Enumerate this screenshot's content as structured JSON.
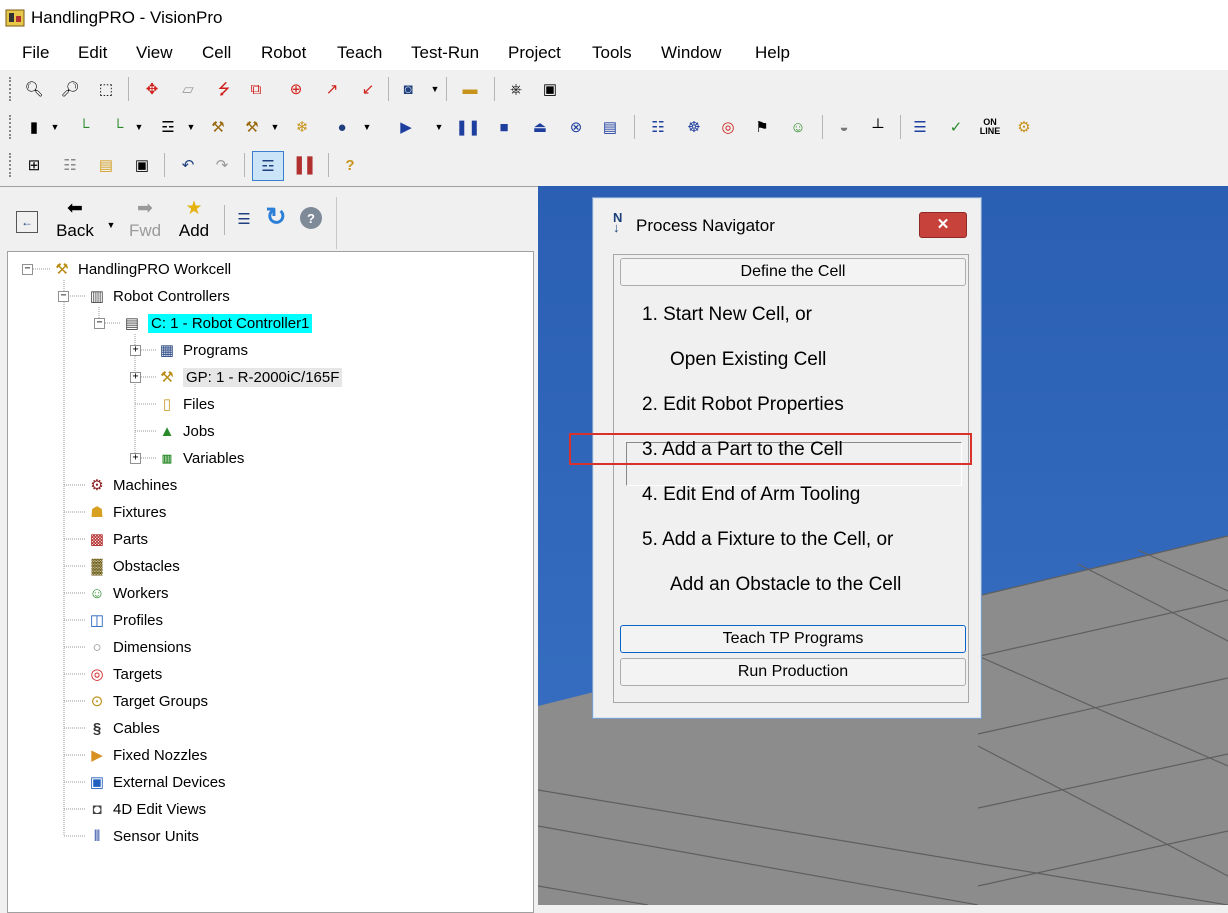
{
  "window": {
    "title": "HandlingPRO - VisionPro"
  },
  "menu": [
    "File",
    "Edit",
    "View",
    "Cell",
    "Robot",
    "Teach",
    "Test-Run",
    "Project",
    "Tools",
    "Window",
    "Help"
  ],
  "toolbar3": {
    "online_top": "ON",
    "online_bottom": "LINE"
  },
  "nav": {
    "back": "Back",
    "fwd": "Fwd",
    "add": "Add"
  },
  "tree": {
    "root": "HandlingPRO Workcell",
    "controllers": "Robot Controllers",
    "controller1": "C: 1 - Robot Controller1",
    "programs": "Programs",
    "robot": "GP: 1 - R-2000iC/165F",
    "files": "Files",
    "jobs": "Jobs",
    "variables": "Variables",
    "machines": "Machines",
    "fixtures": "Fixtures",
    "parts": "Parts",
    "obstacles": "Obstacles",
    "workers": "Workers",
    "profiles": "Profiles",
    "dimensions": "Dimensions",
    "targets": "Targets",
    "target_groups": "Target Groups",
    "cables": "Cables",
    "fixed_nozzles": "Fixed Nozzles",
    "external_devices": "External Devices",
    "edit_views": "4D Edit Views",
    "sensor_units": "Sensor Units"
  },
  "navigator": {
    "title": "Process Navigator",
    "define_cell": "Define the Cell",
    "step1a": "1.  Start New Cell, or",
    "step1b": "Open Existing Cell",
    "step2": "2.  Edit Robot Properties",
    "step3": "3.  Add a Part to the Cell",
    "step4": "4.  Edit End of Arm Tooling",
    "step5a": "5.  Add a Fixture to the Cell, or",
    "step5b": "Add an Obstacle to the Cell",
    "teach": "Teach TP Programs",
    "run": "Run Production"
  },
  "colors": {
    "sky": "#2a5fb4",
    "floor": "#8c8c8c",
    "grid": "#5f5f5f",
    "highlight": "#00ffff",
    "callout": "#d9312b"
  }
}
